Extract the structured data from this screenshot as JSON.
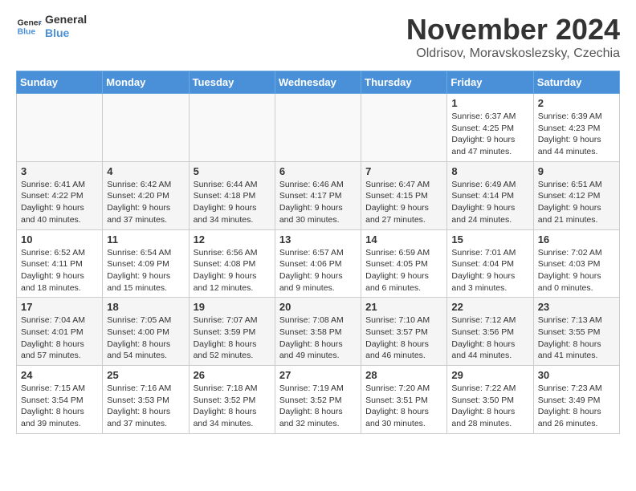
{
  "header": {
    "logo_line1": "General",
    "logo_line2": "Blue",
    "month_title": "November 2024",
    "location": "Oldrisov, Moravskoslezsky, Czechia"
  },
  "days_of_week": [
    "Sunday",
    "Monday",
    "Tuesday",
    "Wednesday",
    "Thursday",
    "Friday",
    "Saturday"
  ],
  "weeks": [
    [
      {
        "day": "",
        "info": ""
      },
      {
        "day": "",
        "info": ""
      },
      {
        "day": "",
        "info": ""
      },
      {
        "day": "",
        "info": ""
      },
      {
        "day": "",
        "info": ""
      },
      {
        "day": "1",
        "info": "Sunrise: 6:37 AM\nSunset: 4:25 PM\nDaylight: 9 hours and 47 minutes."
      },
      {
        "day": "2",
        "info": "Sunrise: 6:39 AM\nSunset: 4:23 PM\nDaylight: 9 hours and 44 minutes."
      }
    ],
    [
      {
        "day": "3",
        "info": "Sunrise: 6:41 AM\nSunset: 4:22 PM\nDaylight: 9 hours and 40 minutes."
      },
      {
        "day": "4",
        "info": "Sunrise: 6:42 AM\nSunset: 4:20 PM\nDaylight: 9 hours and 37 minutes."
      },
      {
        "day": "5",
        "info": "Sunrise: 6:44 AM\nSunset: 4:18 PM\nDaylight: 9 hours and 34 minutes."
      },
      {
        "day": "6",
        "info": "Sunrise: 6:46 AM\nSunset: 4:17 PM\nDaylight: 9 hours and 30 minutes."
      },
      {
        "day": "7",
        "info": "Sunrise: 6:47 AM\nSunset: 4:15 PM\nDaylight: 9 hours and 27 minutes."
      },
      {
        "day": "8",
        "info": "Sunrise: 6:49 AM\nSunset: 4:14 PM\nDaylight: 9 hours and 24 minutes."
      },
      {
        "day": "9",
        "info": "Sunrise: 6:51 AM\nSunset: 4:12 PM\nDaylight: 9 hours and 21 minutes."
      }
    ],
    [
      {
        "day": "10",
        "info": "Sunrise: 6:52 AM\nSunset: 4:11 PM\nDaylight: 9 hours and 18 minutes."
      },
      {
        "day": "11",
        "info": "Sunrise: 6:54 AM\nSunset: 4:09 PM\nDaylight: 9 hours and 15 minutes."
      },
      {
        "day": "12",
        "info": "Sunrise: 6:56 AM\nSunset: 4:08 PM\nDaylight: 9 hours and 12 minutes."
      },
      {
        "day": "13",
        "info": "Sunrise: 6:57 AM\nSunset: 4:06 PM\nDaylight: 9 hours and 9 minutes."
      },
      {
        "day": "14",
        "info": "Sunrise: 6:59 AM\nSunset: 4:05 PM\nDaylight: 9 hours and 6 minutes."
      },
      {
        "day": "15",
        "info": "Sunrise: 7:01 AM\nSunset: 4:04 PM\nDaylight: 9 hours and 3 minutes."
      },
      {
        "day": "16",
        "info": "Sunrise: 7:02 AM\nSunset: 4:03 PM\nDaylight: 9 hours and 0 minutes."
      }
    ],
    [
      {
        "day": "17",
        "info": "Sunrise: 7:04 AM\nSunset: 4:01 PM\nDaylight: 8 hours and 57 minutes."
      },
      {
        "day": "18",
        "info": "Sunrise: 7:05 AM\nSunset: 4:00 PM\nDaylight: 8 hours and 54 minutes."
      },
      {
        "day": "19",
        "info": "Sunrise: 7:07 AM\nSunset: 3:59 PM\nDaylight: 8 hours and 52 minutes."
      },
      {
        "day": "20",
        "info": "Sunrise: 7:08 AM\nSunset: 3:58 PM\nDaylight: 8 hours and 49 minutes."
      },
      {
        "day": "21",
        "info": "Sunrise: 7:10 AM\nSunset: 3:57 PM\nDaylight: 8 hours and 46 minutes."
      },
      {
        "day": "22",
        "info": "Sunrise: 7:12 AM\nSunset: 3:56 PM\nDaylight: 8 hours and 44 minutes."
      },
      {
        "day": "23",
        "info": "Sunrise: 7:13 AM\nSunset: 3:55 PM\nDaylight: 8 hours and 41 minutes."
      }
    ],
    [
      {
        "day": "24",
        "info": "Sunrise: 7:15 AM\nSunset: 3:54 PM\nDaylight: 8 hours and 39 minutes."
      },
      {
        "day": "25",
        "info": "Sunrise: 7:16 AM\nSunset: 3:53 PM\nDaylight: 8 hours and 37 minutes."
      },
      {
        "day": "26",
        "info": "Sunrise: 7:18 AM\nSunset: 3:52 PM\nDaylight: 8 hours and 34 minutes."
      },
      {
        "day": "27",
        "info": "Sunrise: 7:19 AM\nSunset: 3:52 PM\nDaylight: 8 hours and 32 minutes."
      },
      {
        "day": "28",
        "info": "Sunrise: 7:20 AM\nSunset: 3:51 PM\nDaylight: 8 hours and 30 minutes."
      },
      {
        "day": "29",
        "info": "Sunrise: 7:22 AM\nSunset: 3:50 PM\nDaylight: 8 hours and 28 minutes."
      },
      {
        "day": "30",
        "info": "Sunrise: 7:23 AM\nSunset: 3:49 PM\nDaylight: 8 hours and 26 minutes."
      }
    ]
  ]
}
